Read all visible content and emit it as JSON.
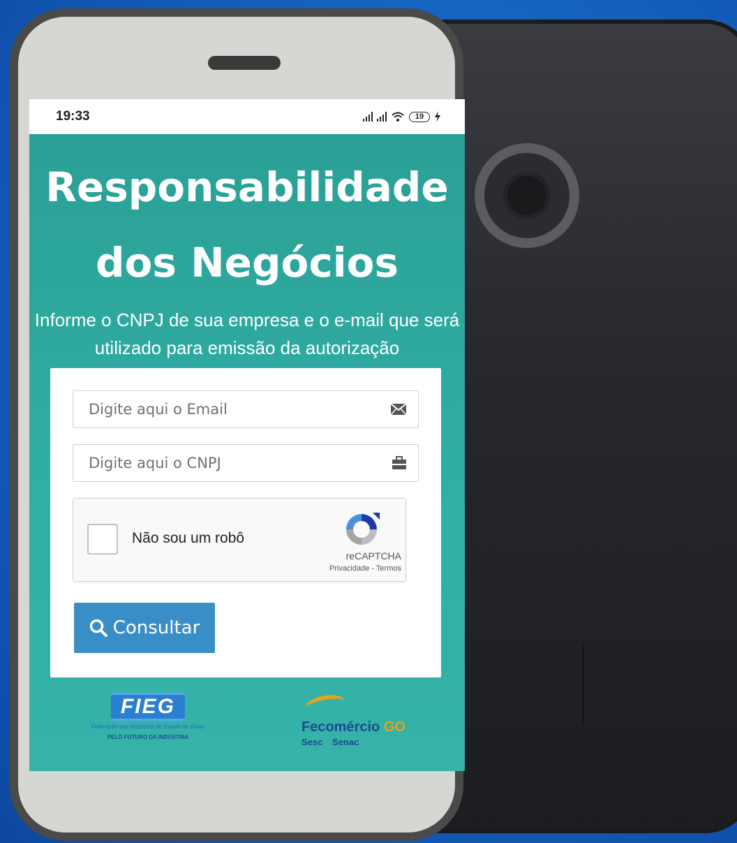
{
  "status_bar": {
    "time": "19:33",
    "battery": "19"
  },
  "page": {
    "title_line1": "Responsabilidade",
    "title_line2": "dos Negócios",
    "subtitle_line1": "Informe o CNPJ de sua empresa e o e-mail que será",
    "subtitle_line2": "utilizado para emissão da autorização"
  },
  "form": {
    "email_placeholder": "Digite aqui o Email",
    "email_icon": "envelope-icon",
    "cnpj_placeholder": "Digite aqui o CNPJ",
    "cnpj_icon": "briefcase-icon",
    "recaptcha": {
      "label": "Não sou um robô",
      "brand": "reCAPTCHA",
      "links": "Privacidade - Termos"
    },
    "submit_label": "Consultar",
    "submit_icon": "search-icon"
  },
  "logos": {
    "fieg": {
      "mark": "FIEG",
      "subtitle": "Federação das Indústrias do Estado de Goiás",
      "tagline": "PELO FUTURO DA INDÚSTRIA"
    },
    "fecomercio": {
      "name": "Fecomércio",
      "region": "GO",
      "sub": "Sesc Senac"
    }
  },
  "colors": {
    "teal": "#2ea79d",
    "button_blue": "#3a8ec7",
    "background_blue": "#1565c0"
  }
}
